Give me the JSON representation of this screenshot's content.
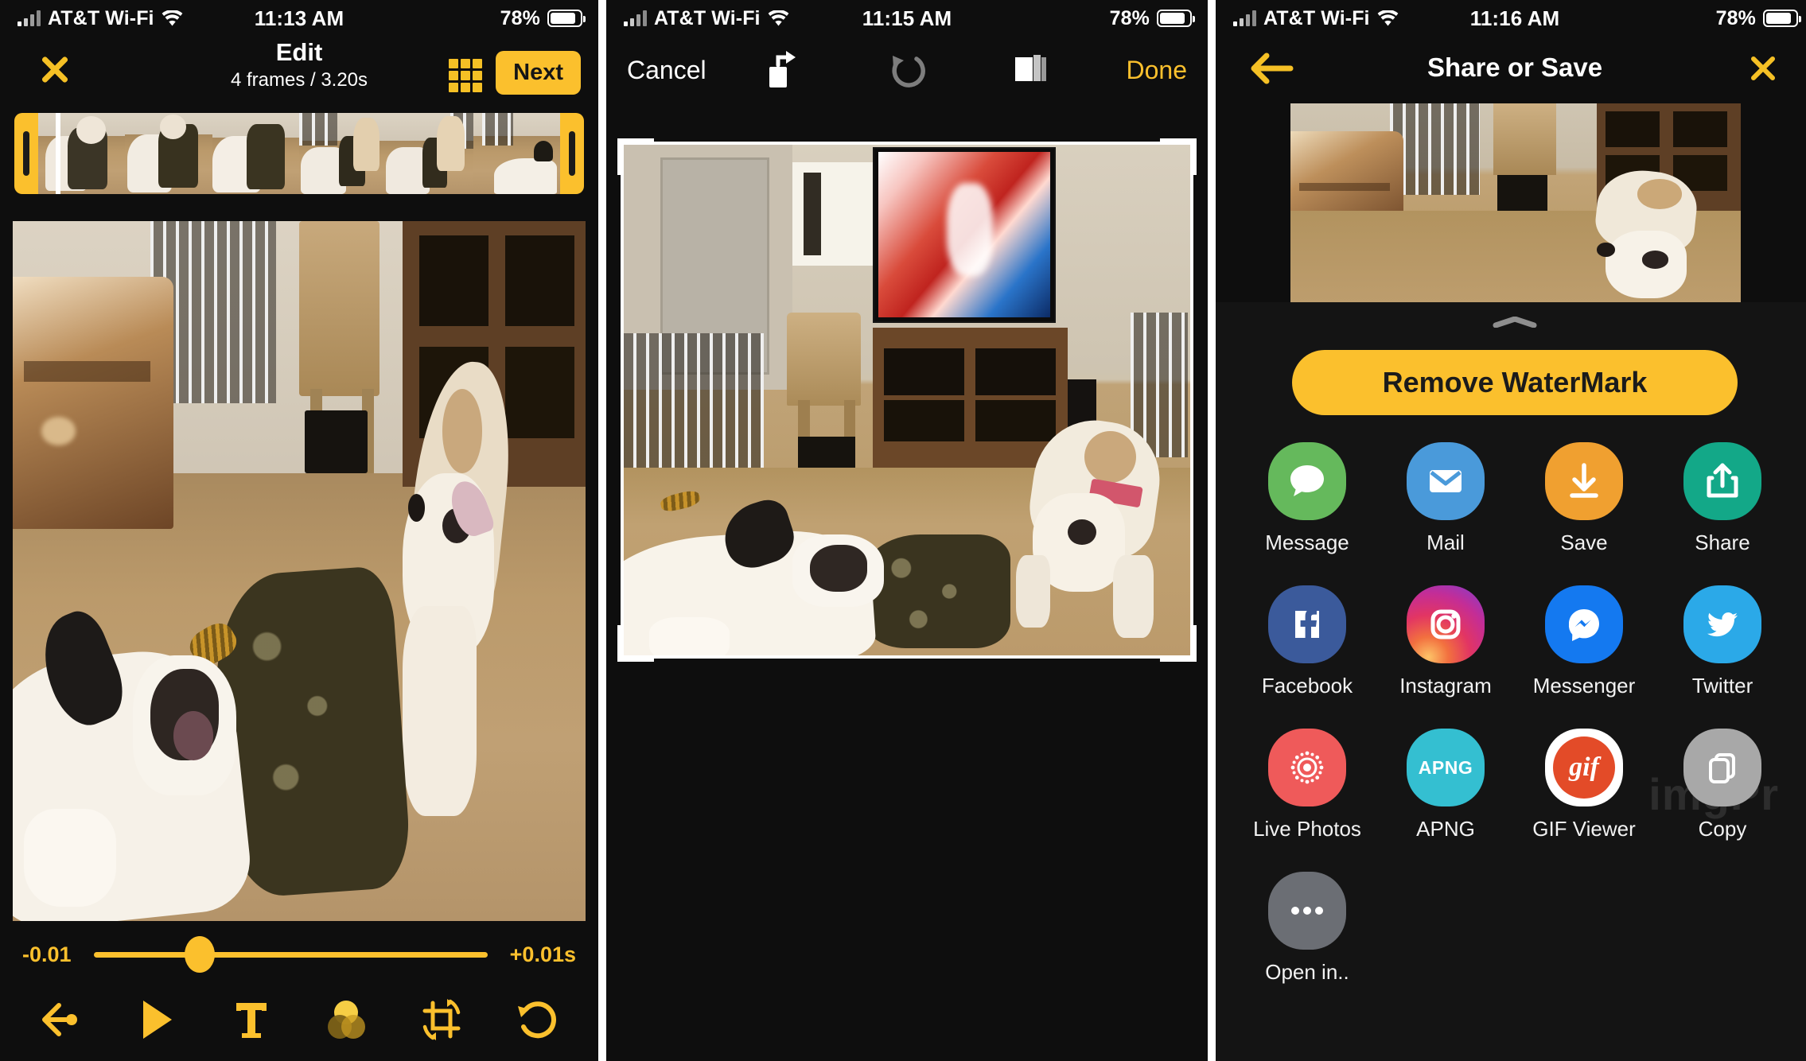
{
  "panels": [
    {
      "id": "edit",
      "status": {
        "carrier": "AT&T Wi-Fi",
        "time": "11:13 AM",
        "battery": "78%"
      },
      "nav": {
        "close_icon": "close-x-icon",
        "title": "Edit",
        "subtitle": "4 frames / 3.20s",
        "grid_icon": "grid-frames-icon",
        "next_label": "Next"
      },
      "filmstrip": {
        "frame_count": 6,
        "trim_left_handle": "trim-handle-left",
        "trim_right_handle": "trim-handle-right",
        "playhead": "playhead"
      },
      "slider": {
        "left_label": "-0.01",
        "right_label": "+0.01s",
        "value_pct": 27
      },
      "toolbar": [
        {
          "name": "speed-arrow-icon",
          "label": "Speed"
        },
        {
          "name": "play-icon",
          "label": "Play"
        },
        {
          "name": "text-icon",
          "label": "T"
        },
        {
          "name": "filters-icon",
          "label": "Filters"
        },
        {
          "name": "crop-rotate-icon",
          "label": "Crop"
        },
        {
          "name": "undo-reset-icon",
          "label": "Reset"
        }
      ]
    },
    {
      "id": "crop",
      "status": {
        "carrier": "AT&T Wi-Fi",
        "time": "11:15 AM",
        "battery": "78%"
      },
      "nav": {
        "cancel_label": "Cancel",
        "rotate_icon": "rotate-icon",
        "undo_icon": "undo-icon",
        "aspect_icon": "aspect-ratio-icon",
        "done_label": "Done"
      },
      "crop": {
        "frame": "crop-frame",
        "handles": [
          "top-left",
          "top-right",
          "bottom-left",
          "bottom-right"
        ]
      }
    },
    {
      "id": "share",
      "status": {
        "carrier": "AT&T Wi-Fi",
        "time": "11:16 AM",
        "battery": "78%"
      },
      "nav": {
        "back_icon": "back-arrow-icon",
        "title": "Share or Save",
        "close_icon": "close-x-icon"
      },
      "sheet": {
        "grabber": "sheet-grabber",
        "watermark_button": "Remove WaterMark",
        "watermark_text": "imgPr",
        "items": [
          {
            "label": "Message",
            "icon": "message-icon",
            "bg": "#65b95c",
            "fg": "#ffffff"
          },
          {
            "label": "Mail",
            "icon": "mail-icon",
            "bg": "#4a9ada",
            "fg": "#ffffff"
          },
          {
            "label": "Save",
            "icon": "download-icon",
            "bg": "#f0a030",
            "fg": "#ffffff"
          },
          {
            "label": "Share",
            "icon": "share-up-icon",
            "bg": "#13a888",
            "fg": "#ffffff"
          },
          {
            "label": "Facebook",
            "icon": "facebook-icon",
            "bg": "#3b5a9b",
            "fg": "#ffffff"
          },
          {
            "label": "Instagram",
            "icon": "instagram-icon",
            "bg": "#d6356c",
            "fg": "#ffffff"
          },
          {
            "label": "Messenger",
            "icon": "messenger-icon",
            "bg": "#1479f0",
            "fg": "#ffffff"
          },
          {
            "label": "Twitter",
            "icon": "twitter-icon",
            "bg": "#2ba9e8",
            "fg": "#ffffff"
          },
          {
            "label": "Live Photos",
            "icon": "live-photos-icon",
            "bg": "#ef5a5a",
            "fg": "#ffffff"
          },
          {
            "label": "APNG",
            "icon": "apng-icon",
            "bg": "#34bfd1",
            "fg": "#ffffff"
          },
          {
            "label": "GIF Viewer",
            "icon": "gif-viewer-icon",
            "bg": "#ffffff",
            "fg": "#e34b28"
          },
          {
            "label": "Copy",
            "icon": "copy-icon",
            "bg": "#a8a8a8",
            "fg": "#ffffff"
          },
          {
            "label": "Open in..",
            "icon": "more-dots-icon",
            "bg": "#6b6e74",
            "fg": "#ffffff"
          }
        ]
      }
    }
  ],
  "colors": {
    "accent": "#fbc02d",
    "background": "#0e0e0e",
    "sheet": "#141414",
    "text": "#ffffff"
  }
}
